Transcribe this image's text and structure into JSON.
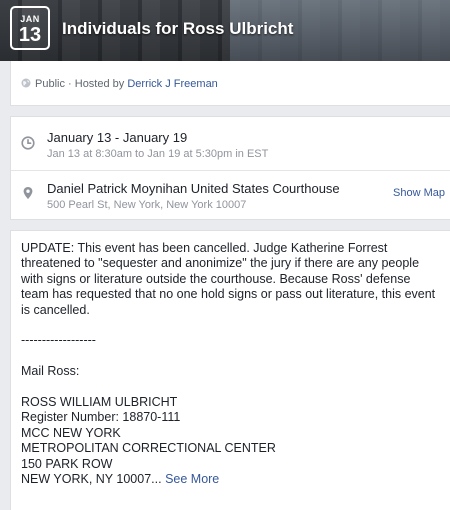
{
  "header": {
    "month": "JAN",
    "day": "13",
    "title": "Individuals for Ross Ulbricht"
  },
  "host": {
    "privacy": "Public",
    "separator": " · ",
    "hosted_by_label": "Hosted by ",
    "host_name": "Derrick J Freeman"
  },
  "when": {
    "range": "January 13 - January 19",
    "detail": "Jan 13 at 8:30am to Jan 19 at 5:30pm in EST"
  },
  "where": {
    "name": "Daniel Patrick Moynihan United States Courthouse",
    "address": "500 Pearl St, New York, New York 10007",
    "show_map": "Show Map"
  },
  "description": {
    "update": "UPDATE: This event has been cancelled. Judge Katherine Forrest threatened to \"sequester and anonimize\" the jury if there are any people with signs or literature outside the courthouse. Because Ross' defense team has requested that no one hold signs or pass out literature, this event is cancelled.",
    "divider": "------------------",
    "mail_label": "Mail Ross:",
    "address_lines": [
      "ROSS WILLIAM ULBRICHT",
      "Register Number: 18870-111",
      "MCC NEW YORK",
      "METROPOLITAN CORRECTIONAL CENTER",
      "150 PARK ROW"
    ],
    "last_line": "NEW YORK, NY 10007...",
    "see_more": "See More"
  },
  "icons": {
    "privacy": "globe-icon",
    "time": "clock-icon",
    "location": "map-pin-icon"
  }
}
